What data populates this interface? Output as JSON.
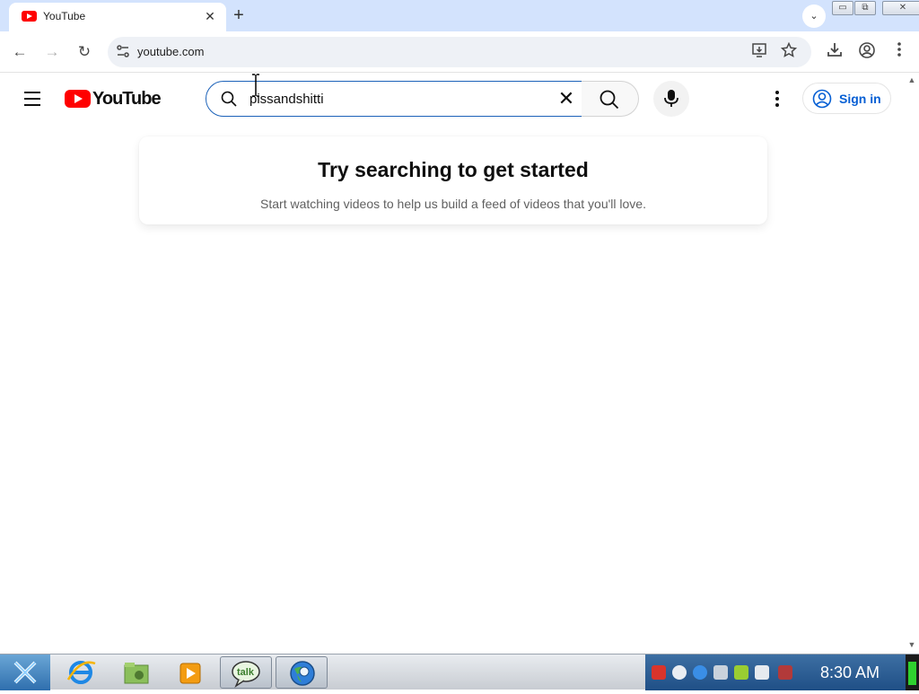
{
  "browser": {
    "tab": {
      "title": "YouTube",
      "close": "✕"
    },
    "new_tab": "+",
    "tab_search": "⌄",
    "window_buttons": {
      "minimize": "▭",
      "restore": "⧉",
      "close": "✕"
    },
    "nav": {
      "back": "←",
      "forward": "→",
      "reload": "↻"
    },
    "omnibox": {
      "url": "youtube.com"
    },
    "icons": [
      "site-settings-icon",
      "install-app-icon",
      "bookmark-star-icon",
      "download-icon",
      "profile-icon",
      "more-menu-icon"
    ]
  },
  "youtube": {
    "logo_text": "YouTube",
    "search": {
      "value": "pissandshitti",
      "clear": "✕"
    },
    "signin_label": "Sign in",
    "card": {
      "title": "Try searching to get started",
      "subtitle": "Start watching videos to help us build a feed of videos that you'll love."
    },
    "colors": {
      "brand_red": "#ff0000",
      "signin_blue": "#065fd4",
      "search_focus": "#1c62b9"
    }
  },
  "taskbar": {
    "clock": "8:30 AM",
    "apps": [
      "internet-explorer-icon",
      "file-manager-icon",
      "media-player-icon",
      "talk-icon",
      "browser-globe-icon"
    ]
  }
}
